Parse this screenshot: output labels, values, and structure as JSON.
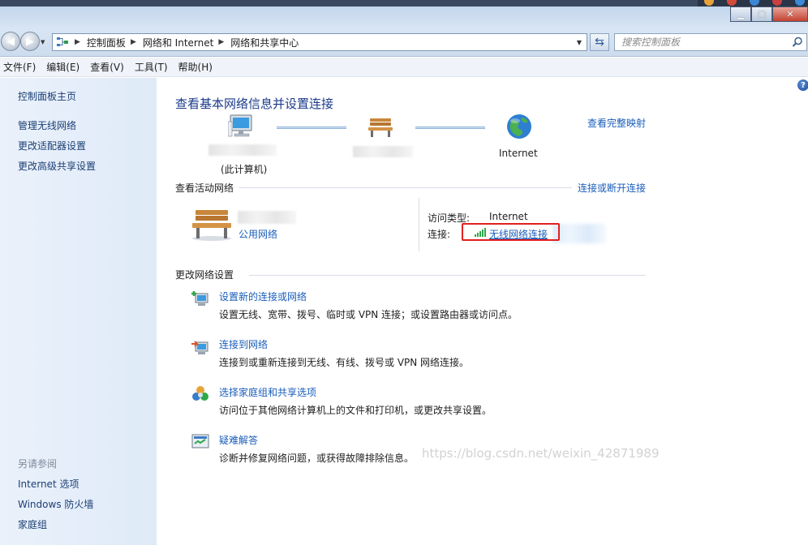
{
  "address": {
    "breadcrumbs": [
      "控制面板",
      "网络和 Internet",
      "网络和共享中心"
    ],
    "search_placeholder": "搜索控制面板"
  },
  "menu": [
    "文件(F)",
    "编辑(E)",
    "查看(V)",
    "工具(T)",
    "帮助(H)"
  ],
  "sidebar": {
    "items": [
      {
        "label": "控制面板主页"
      },
      {
        "label": "管理无线网络"
      },
      {
        "label": "更改适配器设置"
      },
      {
        "label": "更改高级共享设置"
      }
    ],
    "see_also_title": "另请参阅",
    "see_also": [
      {
        "label": "Internet 选项"
      },
      {
        "label": "Windows 防火墙"
      },
      {
        "label": "家庭组"
      }
    ]
  },
  "main": {
    "title": "查看基本网络信息并设置连接",
    "view_full_map": "查看完整映射",
    "map": {
      "this_computer": "(此计算机)",
      "internet": "Internet"
    },
    "active_section_title": "查看活动网络",
    "connect_disconnect": "连接或断开连接",
    "active_network": {
      "type_label": "公用网络",
      "access_type_label": "访问类型:",
      "access_type_value": "Internet",
      "connection_label": "连接:",
      "connection_value": "无线网络连接"
    },
    "change_section_title": "更改网络设置",
    "tasks": [
      {
        "title": "设置新的连接或网络",
        "desc": "设置无线、宽带、拨号、临时或 VPN 连接；或设置路由器或访问点。"
      },
      {
        "title": "连接到网络",
        "desc": "连接到或重新连接到无线、有线、拨号或 VPN 网络连接。"
      },
      {
        "title": "选择家庭组和共享选项",
        "desc": "访问位于其他网络计算机上的文件和打印机，或更改共享设置。"
      },
      {
        "title": "疑难解答",
        "desc": "诊断并修复网络问题，或获得故障排除信息。"
      }
    ]
  },
  "watermark": "https://blog.csdn.net/weixin_42871989"
}
